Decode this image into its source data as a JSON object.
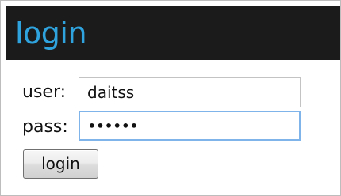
{
  "header": {
    "title": "login"
  },
  "form": {
    "user": {
      "label": "user:",
      "value": "daitss"
    },
    "pass": {
      "label": "pass:",
      "value": "••••••"
    },
    "submit_label": "login"
  },
  "colors": {
    "header_background": "#1b1b1b",
    "header_text": "#2fa3dd",
    "focus_border": "#7eb4ea"
  }
}
